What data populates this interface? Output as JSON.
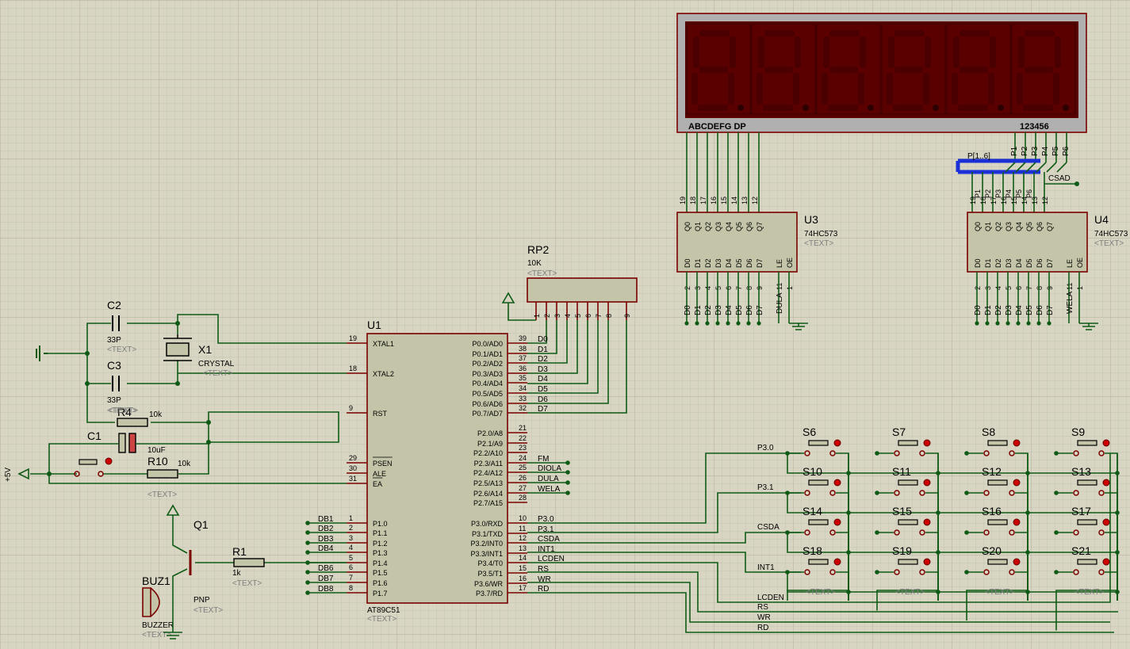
{
  "display": {
    "segment_pins": "ABCDEFG  DP",
    "digit_pins": "123456",
    "digit_count": 6,
    "colors": {
      "frame": "#b0b0b0",
      "bg": "#5a0000",
      "segment": "#4a0000",
      "dp": "#2c0000"
    }
  },
  "rp2": {
    "ref": "RP2",
    "value": "10K",
    "text": "<TEXT>",
    "pins": [
      "1",
      "2",
      "3",
      "4",
      "5",
      "6",
      "7",
      "8",
      "9"
    ]
  },
  "u1": {
    "ref": "U1",
    "part": "AT89C51",
    "text": "<TEXT>",
    "left_pins": [
      {
        "num": "19",
        "name": "XTAL1"
      },
      {
        "num": "18",
        "name": "XTAL2"
      },
      {
        "num": "9",
        "name": "RST"
      },
      {
        "num": "29",
        "name": "PSEN"
      },
      {
        "num": "30",
        "name": "ALE"
      },
      {
        "num": "31",
        "name": "EA"
      },
      {
        "num": "1",
        "name": "P1.0"
      },
      {
        "num": "2",
        "name": "P1.1"
      },
      {
        "num": "3",
        "name": "P1.2"
      },
      {
        "num": "4",
        "name": "P1.3"
      },
      {
        "num": "5",
        "name": "P1.4"
      },
      {
        "num": "6",
        "name": "P1.5"
      },
      {
        "num": "7",
        "name": "P1.6"
      },
      {
        "num": "8",
        "name": "P1.7"
      }
    ],
    "right_pins": [
      {
        "num": "39",
        "name": "P0.0/AD0",
        "net": "D0"
      },
      {
        "num": "38",
        "name": "P0.1/AD1",
        "net": "D1"
      },
      {
        "num": "37",
        "name": "P0.2/AD2",
        "net": "D2"
      },
      {
        "num": "36",
        "name": "P0.3/AD3",
        "net": "D3"
      },
      {
        "num": "35",
        "name": "P0.4/AD4",
        "net": "D4"
      },
      {
        "num": "34",
        "name": "P0.5/AD5",
        "net": "D5"
      },
      {
        "num": "33",
        "name": "P0.6/AD6",
        "net": "D6"
      },
      {
        "num": "32",
        "name": "P0.7/AD7",
        "net": "D7"
      },
      {
        "num": "21",
        "name": "P2.0/A8",
        "net": ""
      },
      {
        "num": "22",
        "name": "P2.1/A9",
        "net": ""
      },
      {
        "num": "23",
        "name": "P2.2/A10",
        "net": ""
      },
      {
        "num": "24",
        "name": "P2.3/A11",
        "net": "FM"
      },
      {
        "num": "25",
        "name": "P2.4/A12",
        "net": "DIOLA"
      },
      {
        "num": "26",
        "name": "P2.5/A13",
        "net": "DULA"
      },
      {
        "num": "27",
        "name": "P2.6/A14",
        "net": "WELA"
      },
      {
        "num": "28",
        "name": "P2.7/A15",
        "net": ""
      },
      {
        "num": "10",
        "name": "P3.0/RXD",
        "net": "P3.0"
      },
      {
        "num": "11",
        "name": "P3.1/TXD",
        "net": "P3.1"
      },
      {
        "num": "12",
        "name": "P3.2/INT0",
        "net": "CSDA"
      },
      {
        "num": "13",
        "name": "P3.3/INT1",
        "net": "INT1"
      },
      {
        "num": "14",
        "name": "P3.4/T0",
        "net": "LCDEN"
      },
      {
        "num": "15",
        "name": "P3.5/T1",
        "net": "RS"
      },
      {
        "num": "16",
        "name": "P3.6/WR",
        "net": "WR"
      },
      {
        "num": "17",
        "name": "P3.7/RD",
        "net": "RD"
      }
    ],
    "p1_nets": [
      "DB1",
      "DB2",
      "DB3",
      "DB4",
      "",
      "DB6",
      "DB7",
      "DB8"
    ]
  },
  "u3": {
    "ref": "U3",
    "part": "74HC573",
    "text": "<TEXT>",
    "q_pins": [
      "Q0",
      "Q1",
      "Q2",
      "Q3",
      "Q4",
      "Q5",
      "Q6",
      "Q7"
    ],
    "q_nums": [
      "19",
      "18",
      "17",
      "16",
      "15",
      "14",
      "13",
      "12"
    ],
    "d_pins": [
      "D0",
      "D1",
      "D2",
      "D3",
      "D4",
      "D5",
      "D6",
      "D7"
    ],
    "d_nums": [
      "2",
      "3",
      "4",
      "5",
      "6",
      "7",
      "8",
      "9"
    ],
    "d_nets": [
      "D0",
      "D1",
      "D2",
      "D3",
      "D4",
      "D5",
      "D6",
      "D7"
    ],
    "le": "LE",
    "oe": "OE",
    "le_num": "11",
    "oe_num": "1",
    "le_net": "DULA"
  },
  "u4": {
    "ref": "U4",
    "part": "74HC573",
    "text": "<TEXT>",
    "q_pins": [
      "Q0",
      "Q1",
      "Q2",
      "Q3",
      "Q4",
      "Q5",
      "Q6",
      "Q7"
    ],
    "q_nums": [
      "19",
      "18",
      "17",
      "16",
      "15",
      "14",
      "13",
      "12"
    ],
    "q_nets": [
      "P1",
      "P2",
      "P3",
      "P4",
      "P5",
      "P6",
      "",
      ""
    ],
    "d_pins": [
      "D0",
      "D1",
      "D2",
      "D3",
      "D4",
      "D5",
      "D6",
      "D7"
    ],
    "d_nums": [
      "2",
      "3",
      "4",
      "5",
      "6",
      "7",
      "8",
      "9"
    ],
    "d_nets": [
      "D0",
      "D1",
      "D2",
      "D3",
      "D4",
      "D5",
      "D6",
      "D7"
    ],
    "le": "LE",
    "oe": "OE",
    "le_num": "11",
    "oe_num": "1",
    "le_net": "WELA"
  },
  "bus": {
    "label": "P[1..6]",
    "nets": [
      "P1",
      "P2",
      "P3",
      "P4",
      "P5",
      "P6"
    ],
    "csad": "CSAD",
    "color": "#1a2fd6"
  },
  "parts": {
    "c2": {
      "ref": "C2",
      "value": "33P",
      "text": "<TEXT>"
    },
    "c3": {
      "ref": "C3",
      "value": "33P",
      "text": "<TEXT>"
    },
    "x1": {
      "ref": "X1",
      "value": "CRYSTAL",
      "text": "<TEXT>"
    },
    "r4": {
      "ref": "R4",
      "value": "10k",
      "text": "<TEXT>"
    },
    "c1": {
      "ref": "C1",
      "value": "10uF"
    },
    "r10": {
      "ref": "R10",
      "value": "10k",
      "text": "<TEXT>"
    },
    "power": "+5V",
    "q1": {
      "ref": "Q1",
      "value": "PNP",
      "text": "<TEXT>"
    },
    "r1": {
      "ref": "R1",
      "value": "1k",
      "text": "<TEXT>"
    },
    "buz1": {
      "ref": "BUZ1",
      "value": "BUZZER",
      "text": "<TEXT>"
    }
  },
  "keypad": {
    "switches": [
      [
        "S6",
        "S7",
        "S8",
        "S9"
      ],
      [
        "S10",
        "S11",
        "S12",
        "S13"
      ],
      [
        "S14",
        "S15",
        "S16",
        "S17"
      ],
      [
        "S18",
        "S19",
        "S20",
        "S21"
      ]
    ],
    "row_nets": [
      "P3.0",
      "P3.1",
      "CSDA",
      "INT1"
    ],
    "col_nets": [
      "LCDEN",
      "RS",
      "WR",
      "RD"
    ],
    "text": "<TEXT>"
  }
}
